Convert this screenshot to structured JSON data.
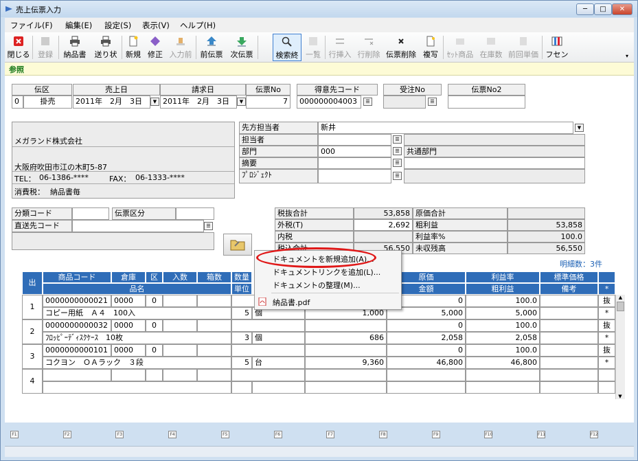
{
  "window": {
    "title": "売上伝票入力",
    "controls": [
      "─",
      "□",
      "✕"
    ]
  },
  "menu": [
    "ファイル(F)",
    "編集(E)",
    "設定(S)",
    "表示(V)",
    "ヘルプ(H)"
  ],
  "toolbar": [
    {
      "label": "閉じる",
      "icon": "close-icon",
      "enabled": true
    },
    {
      "label": "登録",
      "icon": "register-icon",
      "enabled": false
    },
    {
      "label": "納品書",
      "icon": "printer-icon",
      "enabled": true
    },
    {
      "label": "送り状",
      "icon": "printer-icon",
      "enabled": true
    },
    {
      "label": "新規",
      "icon": "new-doc-icon",
      "enabled": true
    },
    {
      "label": "修正",
      "icon": "eraser-icon",
      "enabled": true
    },
    {
      "label": "入力前",
      "icon": "undo-icon",
      "enabled": false
    },
    {
      "label": "前伝票",
      "icon": "up-arrow-icon",
      "enabled": true
    },
    {
      "label": "次伝票",
      "icon": "down-arrow-icon",
      "enabled": true
    },
    {
      "label": "検索終",
      "icon": "search-icon",
      "enabled": true
    },
    {
      "label": "一覧",
      "icon": "list-icon",
      "enabled": false
    },
    {
      "label": "行挿入",
      "icon": "insert-row-icon",
      "enabled": false
    },
    {
      "label": "行削除",
      "icon": "delete-row-icon",
      "enabled": false
    },
    {
      "label": "伝票削除",
      "icon": "delete-doc-icon",
      "enabled": true
    },
    {
      "label": "複写",
      "icon": "copy-icon",
      "enabled": true
    },
    {
      "label": "ｾｯﾄ商品",
      "icon": "set-item-icon",
      "enabled": false
    },
    {
      "label": "在庫数",
      "icon": "stock-icon",
      "enabled": false
    },
    {
      "label": "前回単価",
      "icon": "price-icon",
      "enabled": false
    },
    {
      "label": "フセン",
      "icon": "sticky-note-icon",
      "enabled": true
    }
  ],
  "tab": "参照",
  "header": {
    "labels": {
      "denku": "伝区",
      "uriagebi": "売上日",
      "seikyubi": "請求日",
      "denpyo_no": "伝票No",
      "tokuisaki": "得意先コード",
      "juchu_no": "受注No",
      "denpyo_no2": "伝票No2"
    },
    "denku_code": "0",
    "denku_name": "掛売",
    "uriagebi": "2011年　2月　3日",
    "seikyubi": "2011年　2月　3日",
    "denpyo_no": "7",
    "tokuisaki_code": "000000004003",
    "juchu_no": "",
    "denpyo_no2": ""
  },
  "customer": {
    "name": "メガランド株式会社",
    "address": "大阪府吹田市江の木町5-87",
    "tel_label": "TEL：",
    "tel": "06-1386-****",
    "fax_label": "FAX：",
    "fax": "06-1333-****",
    "tax_label": "消費税：",
    "tax": "納品書毎"
  },
  "right_info": {
    "labels": [
      "先方担当者",
      "担当者",
      "部門",
      "摘要",
      "ﾌﾟﾛｼﾞｪｸﾄ"
    ],
    "senpo": "新井",
    "tanto": "",
    "bumon_code": "000",
    "bumon_name": "共通部門",
    "tekiyo": "",
    "project": ""
  },
  "classify": {
    "bunrui_label": "分類コード",
    "denpyo_kubun_label": "伝票区分",
    "chokuso_label": "直送先コード"
  },
  "totals": {
    "zeinuki_label": "税抜合計",
    "zeinuki": "53,858",
    "genka_label": "原価合計",
    "genka": "",
    "sotozei_label": "外税(T)",
    "sotozei": "2,692",
    "arari_label": "粗利益",
    "arari": "53,858",
    "uchizei_label": "内税",
    "uchizei": "",
    "arariritsu_label": "利益率%",
    "arariritsu": "100.0",
    "zeikomi_label": "税込合計",
    "zeikomi": "56,550",
    "mishu_label": "未収残高",
    "mishu": "56,550"
  },
  "meisai_count": "明細数：3件",
  "grid": {
    "headers_top": [
      "出",
      "商品コード",
      "倉庫",
      "区",
      "入数",
      "箱数",
      "数量",
      "単価",
      "原価",
      "利益率",
      "標準価格"
    ],
    "headers_bottom": [
      "品名",
      "単位",
      "金額",
      "金額",
      "粗利益",
      "備考",
      "*"
    ],
    "rows": [
      {
        "no": "1",
        "code": "0000000000021",
        "soko": "0000",
        "ku": "0",
        "name": "コピー用紙　Ａ４　100入",
        "qty": "5",
        "unit": "個",
        "tanka": "1,000",
        "kingaku": "5,000",
        "genka": "0",
        "riekiritsu": "100.0",
        "arari": "5,000",
        "flag1": "抜",
        "flag2": "*"
      },
      {
        "no": "2",
        "code": "0000000000032",
        "soko": "0000",
        "ku": "0",
        "name": "ﾌﾛｯﾋﾟｰﾃﾞｨｽｸｹｰｽ　10枚",
        "qty": "3",
        "unit": "個",
        "tanka": "686",
        "kingaku": "2,058",
        "genka": "0",
        "riekiritsu": "100.0",
        "arari": "2,058",
        "flag1": "抜",
        "flag2": "*"
      },
      {
        "no": "3",
        "code": "0000000000101",
        "soko": "0000",
        "ku": "0",
        "name": "コクヨン　ＯＡラック　３段",
        "qty": "5",
        "unit": "台",
        "tanka": "9,360",
        "kingaku": "46,800",
        "genka": "0",
        "riekiritsu": "100.0",
        "arari": "46,800",
        "flag1": "抜",
        "flag2": "*"
      },
      {
        "no": "4"
      }
    ]
  },
  "context_menu": [
    "ドキュメントを新規追加(A)...",
    "ドキュメントリンクを追加(L)...",
    "ドキュメントの整理(M)...",
    "納品書.pdf"
  ],
  "fkeys": [
    "F1",
    "F2",
    "F3",
    "F4",
    "F5",
    "F6",
    "F7",
    "F8",
    "F9",
    "F10",
    "F11",
    "F12"
  ],
  "colors": {
    "accent_blue": "#2f6db8",
    "highlight_oval": "#e01818",
    "tab_bg": "#fdfbd6"
  }
}
